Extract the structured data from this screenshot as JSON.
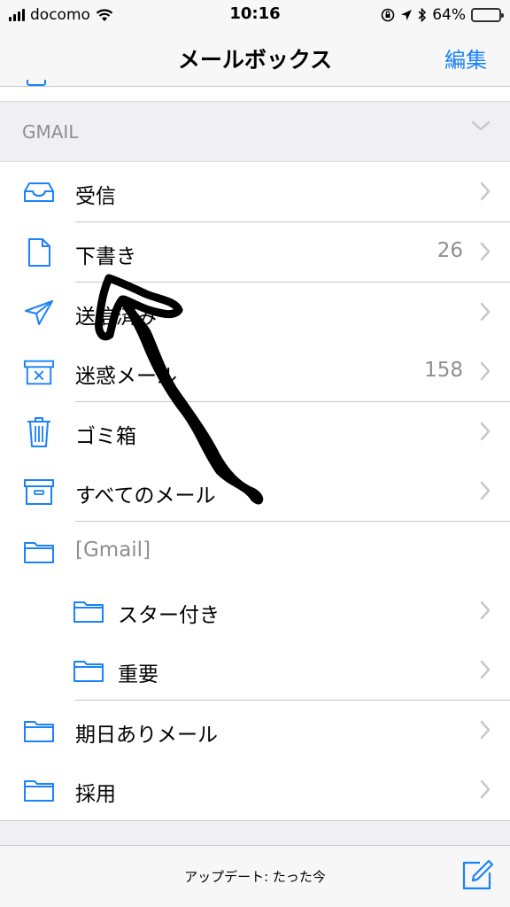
{
  "status_bar": {
    "carrier": "docomo",
    "time": "10:16",
    "battery": "64%",
    "battery_level": 0.64,
    "battery_color": "#4cd964"
  },
  "nav": {
    "title": "メールボックス",
    "edit": "編集"
  },
  "section": {
    "label": "GMAIL"
  },
  "mailboxes": [
    {
      "label": "受信",
      "count": "",
      "icon": "inbox-icon"
    },
    {
      "label": "下書き",
      "count": "26",
      "icon": "draft-icon"
    },
    {
      "label": "送信済み",
      "count": "",
      "icon": "sent-icon"
    },
    {
      "label": "迷惑メール",
      "count": "158",
      "icon": "junk-icon"
    },
    {
      "label": "ゴミ箱",
      "count": "",
      "icon": "trash-icon"
    },
    {
      "label": "すべてのメール",
      "count": "",
      "icon": "archive-icon"
    },
    {
      "label": "[Gmail]",
      "count": "",
      "icon": "folder-icon"
    },
    {
      "label": "スター付き",
      "count": "",
      "icon": "folder-icon"
    },
    {
      "label": "重要",
      "count": "",
      "icon": "folder-icon"
    },
    {
      "label": "期日ありメール",
      "count": "",
      "icon": "folder-icon"
    },
    {
      "label": "採用",
      "count": "",
      "icon": "folder-icon"
    }
  ],
  "toolbar": {
    "status": "アップデート: たった今",
    "compose_icon": "compose-icon"
  },
  "colors": {
    "accent": "#1a82fb",
    "separator": "#c8c8cc",
    "annotation": "#000000"
  }
}
